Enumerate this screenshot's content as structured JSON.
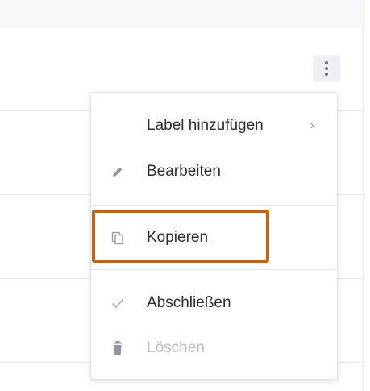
{
  "menu": {
    "items": [
      {
        "id": "add-label",
        "label": "Label hinzufügen",
        "icon": "none",
        "has_submenu": true,
        "chevron": "›",
        "disabled": false
      },
      {
        "id": "edit",
        "label": "Bearbeiten",
        "icon": "pencil-icon",
        "has_submenu": false,
        "disabled": false
      },
      {
        "id": "copy",
        "label": "Kopieren",
        "icon": "copy-icon",
        "has_submenu": false,
        "disabled": false,
        "highlighted": true
      },
      {
        "id": "complete",
        "label": "Abschließen",
        "icon": "check-icon",
        "has_submenu": false,
        "disabled": false
      },
      {
        "id": "delete",
        "label": "Löschen",
        "icon": "trash-icon",
        "has_submenu": false,
        "disabled": true
      }
    ]
  },
  "kebab": {
    "icon": "more-vertical-icon"
  },
  "colors": {
    "highlight_border": "#c0631a",
    "text": "#2a2d31",
    "disabled_text": "#b9bcc0",
    "icon": "#8f959b"
  }
}
